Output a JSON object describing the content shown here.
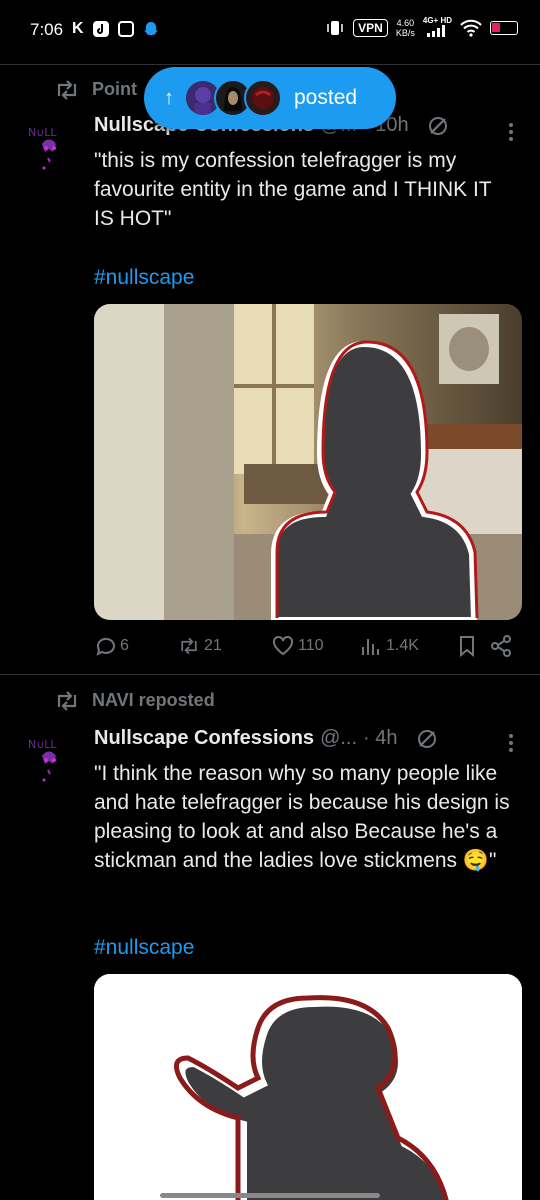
{
  "status_bar": {
    "time": "7:06",
    "k_icon": "K",
    "vpn": "VPN",
    "speed_value": "4.60",
    "speed_unit": "KB/s",
    "network": "4G+ HD",
    "icons": [
      "k-icon",
      "tiktok-icon",
      "sim-icon",
      "snapchat-icon",
      "vibrate-icon",
      "signal-icon",
      "wifi-icon",
      "battery-icon"
    ]
  },
  "new_posts_pill": {
    "arrow": "↑",
    "label": "posted"
  },
  "posts": [
    {
      "repost_label": "Point",
      "author": "Nullscape Confessions",
      "handle": "@...",
      "time": "· 10h",
      "text": "\"this is my confession telefragger is my favourite entity in the game and I THINK IT IS HOT\"",
      "hashtag": "#nullscape",
      "stats": {
        "replies": "6",
        "reposts": "21",
        "likes": "110",
        "views": "1.4K"
      }
    },
    {
      "repost_label": "NAVI reposted",
      "author": "Nullscape Confessions",
      "handle": "@...",
      "time": "· 4h",
      "text": "\"I think the reason why so many people like and hate telefragger is because his design is pleasing to look at and also Because he's a stickman and the ladies love stickmens 🤤\"",
      "hashtag": "#nullscape"
    }
  ],
  "colors": {
    "background": "#000000",
    "accent": "#1d9bf0",
    "text": "#e7e9ea",
    "muted": "#71767b"
  }
}
